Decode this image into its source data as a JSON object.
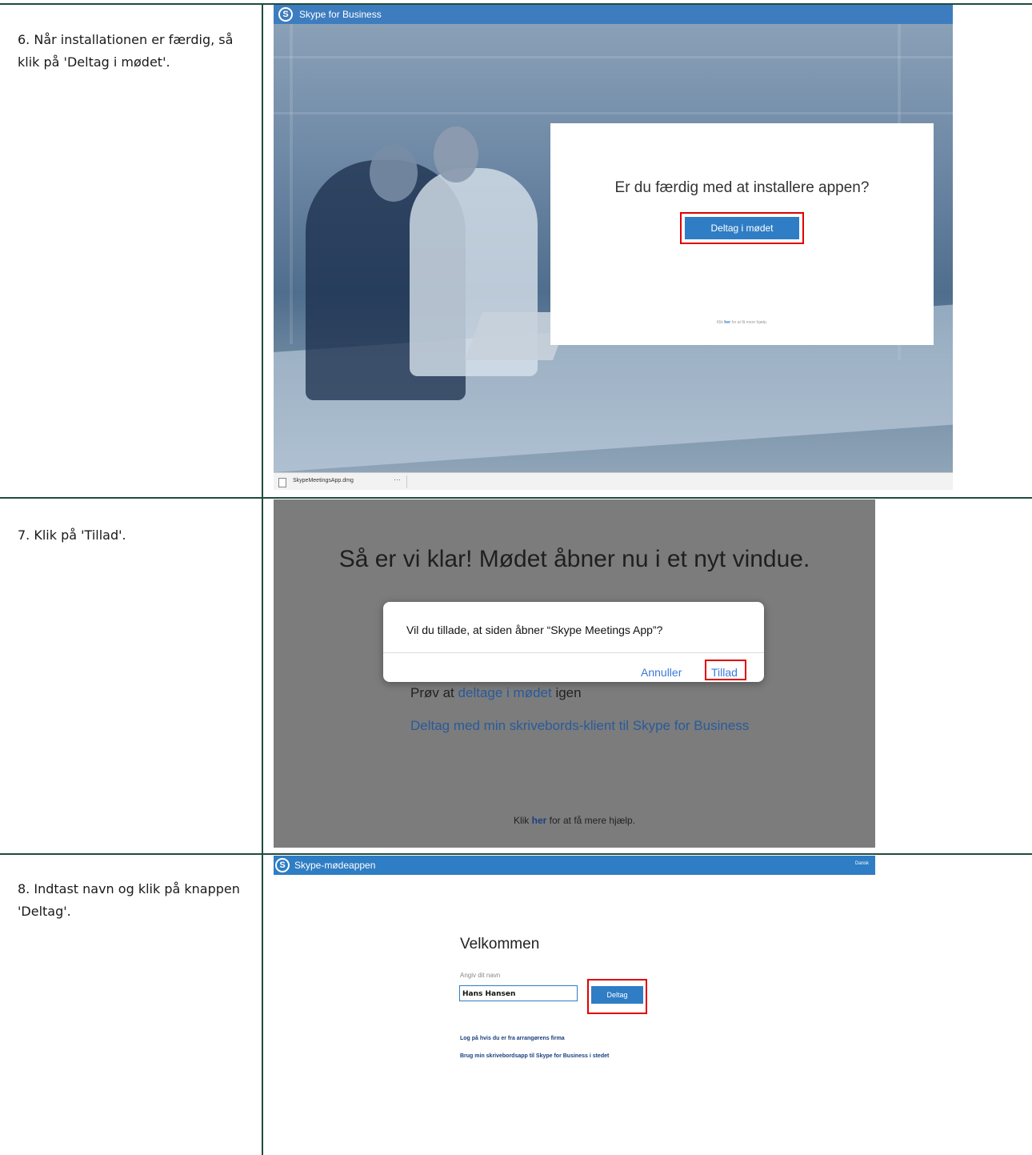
{
  "steps": [
    {
      "text": "6. Når installationen er færdig, så klik på 'Deltag i mødet'."
    },
    {
      "text": "7. Klik på 'Tillad'."
    },
    {
      "text": "8. Indtast navn og klik på knappen 'Deltag'."
    }
  ],
  "shot1": {
    "logo_letter": "S",
    "app_title": "Skype for Business",
    "dialog_question": "Er du færdig med at installere appen?",
    "join_button": "Deltag i mødet",
    "help_prefix": "Klik",
    "help_link": "her",
    "help_suffix": "for at få mere hjælp.",
    "download_file": "SkypeMeetingsApp.dmg",
    "download_more": "···"
  },
  "shot2": {
    "headline": "Så er vi klar! Mødet åbner nu i et nyt vindue.",
    "retry_prefix": "Prøv at",
    "retry_link": "deltage i mødet",
    "retry_suffix": "igen",
    "desktop_link": "Deltag med min skrivebords-klient til Skype for Business",
    "help_prefix": "Klik",
    "help_link": "her",
    "help_suffix": "for at få mere hjælp.",
    "modal_message": "Vil du tillade, at siden åbner “Skype Meetings App”?",
    "cancel_button": "Annuller",
    "allow_button": "Tillad"
  },
  "shot3": {
    "logo_letter": "S",
    "app_title": "Skype-mødeappen",
    "language": "Dansk",
    "welcome": "Velkommen",
    "name_label": "Angiv dit navn",
    "name_value": "Hans Hansen",
    "join_button": "Deltag",
    "signin_link": "Log på hvis du er fra arrangørens firma",
    "desktop_link": "Brug min skrivebordsapp til Skype for Business i stedet"
  },
  "colors": {
    "rule": "#1d4d3a",
    "skype_blue": "#2f7dc4",
    "highlight_red": "#e00000"
  }
}
